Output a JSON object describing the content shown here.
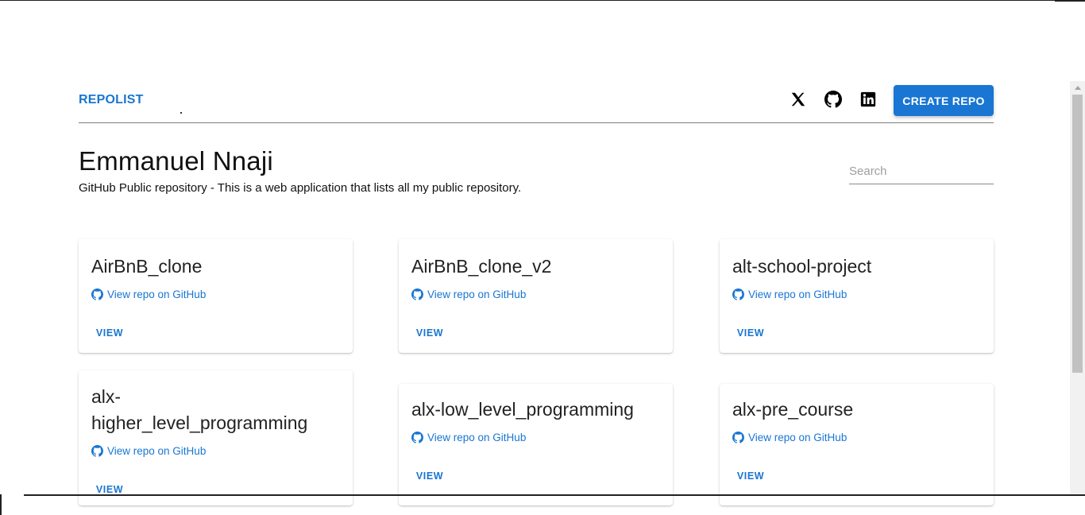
{
  "navbar": {
    "brand": "REPOLIST",
    "social": [
      "x-icon",
      "github-icon",
      "linkedin-icon"
    ],
    "create_button": "CREATE REPO"
  },
  "header": {
    "title": "Emmanuel Nnaji",
    "subtitle": "GitHub Public repository - This is a web application that lists all my public repository."
  },
  "search": {
    "placeholder": "Search",
    "value": ""
  },
  "repos": [
    {
      "name": "AirBnB_clone",
      "link": "View repo on GitHub",
      "action": "VIEW"
    },
    {
      "name": "AirBnB_clone_v2",
      "link": "View repo on GitHub",
      "action": "VIEW"
    },
    {
      "name": "alt-school-project",
      "link": "View repo on GitHub",
      "action": "VIEW"
    },
    {
      "name": "alx-higher_level_programming",
      "link": "View repo on GitHub",
      "action": "VIEW"
    },
    {
      "name": "alx-low_level_programming",
      "link": "View repo on GitHub",
      "action": "VIEW"
    },
    {
      "name": "alx-pre_course",
      "link": "View repo on GitHub",
      "action": "VIEW"
    }
  ],
  "colors": {
    "accent": "#1976d2",
    "text": "#202124"
  }
}
